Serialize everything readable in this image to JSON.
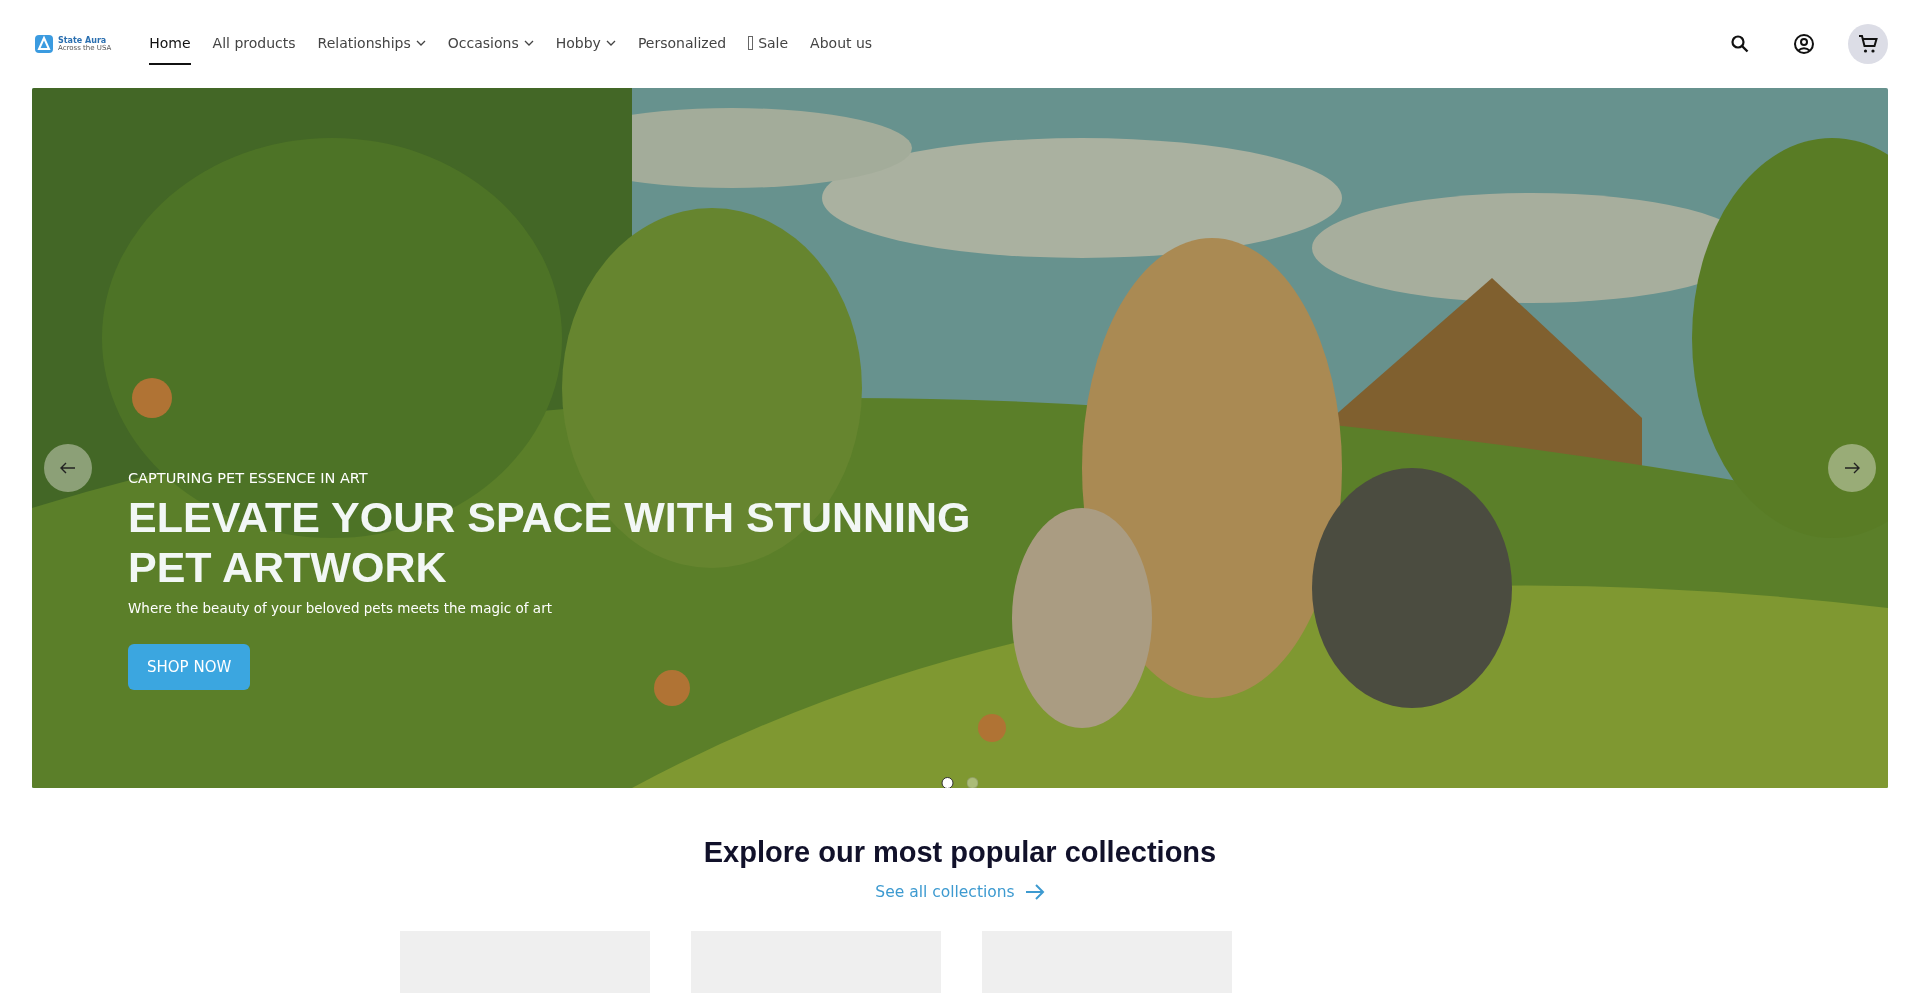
{
  "header": {
    "logo": {
      "name": "State Aura",
      "tagline": "Across the USA"
    },
    "nav": [
      {
        "label": "Home",
        "selected": true,
        "dropdown": false,
        "icon": false
      },
      {
        "label": "All products",
        "selected": false,
        "dropdown": false,
        "icon": false
      },
      {
        "label": "Relationships",
        "selected": false,
        "dropdown": true,
        "icon": false
      },
      {
        "label": "Occasions",
        "selected": false,
        "dropdown": true,
        "icon": false
      },
      {
        "label": "Hobby",
        "selected": false,
        "dropdown": true,
        "icon": false
      },
      {
        "label": "Personalized",
        "selected": false,
        "dropdown": false,
        "icon": false
      },
      {
        "label": "Sale",
        "selected": false,
        "dropdown": false,
        "icon": true
      },
      {
        "label": "About us",
        "selected": false,
        "dropdown": false,
        "icon": false
      }
    ]
  },
  "hero": {
    "kind": "picture",
    "eyebrow": "CAPTURING PET ESSENCE IN ART",
    "title": "ELEVATE YOUR SPACE WITH STUNNING PET ARTWORK",
    "subtitle": "Where the beauty of your beloved pets meets the magic of art",
    "button": "SHOP NOW",
    "dots": [
      {
        "selected": true
      },
      {
        "selected": false
      }
    ]
  },
  "collections": {
    "title": "Explore our most popular collections",
    "link": "See all collections"
  }
}
